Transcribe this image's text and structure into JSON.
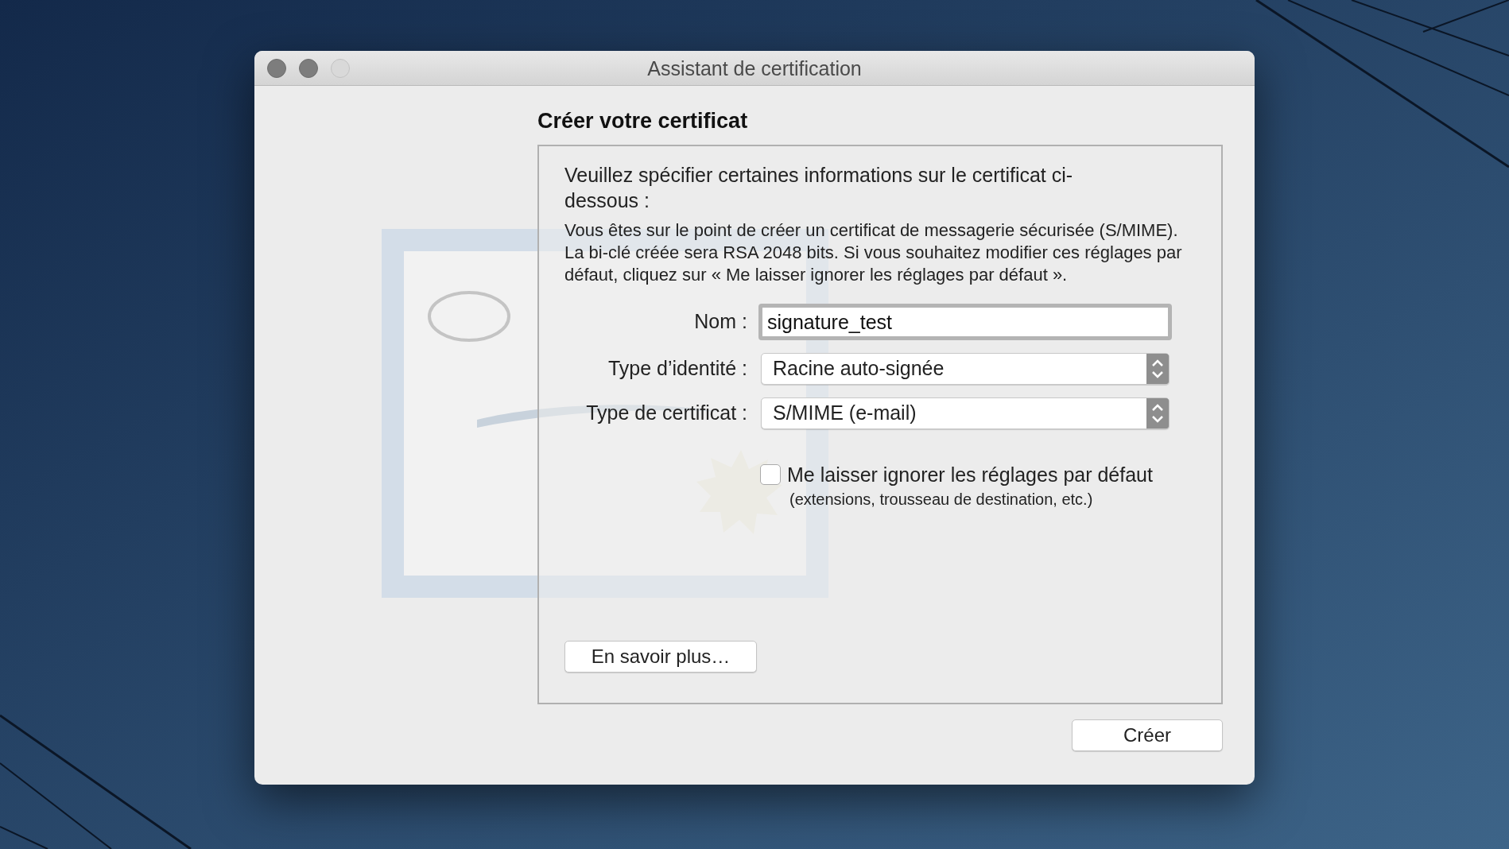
{
  "window": {
    "title": "Assistant de certification",
    "traffic_lights": [
      {
        "disabled": false
      },
      {
        "disabled": false
      },
      {
        "disabled": true
      }
    ]
  },
  "heading": "Créer votre certificat",
  "panel": {
    "intro": "Veuillez spécifier certaines informations sur le certificat ci-dessous :",
    "description": "Vous êtes sur le point de créer un certificat de messagerie sécurisée (S/MIME). La bi-clé créée sera RSA 2048 bits. Si vous souhaitez modifier ces réglages par défaut, cliquez sur « Me laisser ignorer les réglages par défaut ».",
    "fields": [
      {
        "kind": "text",
        "label": "Nom :",
        "value": "signature_test"
      },
      {
        "kind": "popup",
        "label": "Type d’identité :",
        "value": "Racine auto-signée"
      },
      {
        "kind": "popup",
        "label": "Type de certificat :",
        "value": "S/MIME (e-mail)"
      }
    ],
    "checkbox": {
      "label": "Me laisser ignorer les réglages par défaut",
      "note": "(extensions, trousseau de destination, etc.)",
      "checked": false
    },
    "learn_more_button": "En savoir plus…"
  },
  "create_button": "Créer"
}
